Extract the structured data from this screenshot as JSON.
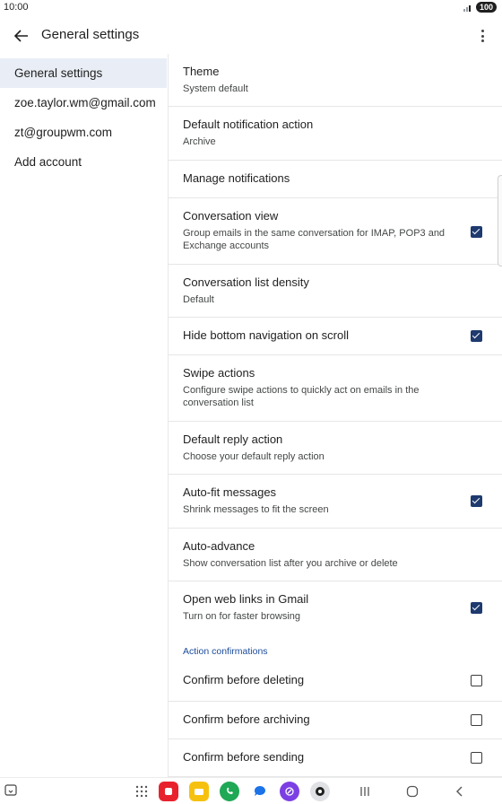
{
  "status": {
    "time": "10:00",
    "battery": "100"
  },
  "app_bar": {
    "title": "General settings"
  },
  "sidebar": {
    "items": [
      {
        "label": "General settings"
      },
      {
        "label": "zoe.taylor.wm@gmail.com"
      },
      {
        "label": "zt@groupwm.com"
      },
      {
        "label": "Add account"
      }
    ]
  },
  "settings": [
    {
      "title": "Theme",
      "subtitle": "System default"
    },
    {
      "title": "Default notification action",
      "subtitle": "Archive"
    },
    {
      "title": "Manage notifications"
    },
    {
      "title": "Conversation view",
      "subtitle": "Group emails in the same conversation for IMAP, POP3 and Exchange accounts",
      "checked": true
    },
    {
      "title": "Conversation list density",
      "subtitle": "Default"
    },
    {
      "title": "Hide bottom navigation on scroll",
      "checked": true
    },
    {
      "title": "Swipe actions",
      "subtitle": "Configure swipe actions to quickly act on emails in the conversation list"
    },
    {
      "title": "Default reply action",
      "subtitle": "Choose your default reply action"
    },
    {
      "title": "Auto-fit messages",
      "subtitle": "Shrink messages to fit the screen",
      "checked": true
    },
    {
      "title": "Auto-advance",
      "subtitle": "Show conversation list after you archive or delete"
    },
    {
      "title": "Open web links in Gmail",
      "subtitle": "Turn on for faster browsing",
      "checked": true
    }
  ],
  "action_confirmations": {
    "header": "Action confirmations",
    "items": [
      {
        "title": "Confirm before deleting",
        "checked": false
      },
      {
        "title": "Confirm before archiving",
        "checked": false
      },
      {
        "title": "Confirm before sending",
        "checked": false
      }
    ]
  },
  "nav_bar": {
    "dock_apps": [
      "app-drawer-icon",
      "red-app-icon",
      "notes-app-icon",
      "whatsapp-icon",
      "messages-icon",
      "browser-icon",
      "camera-icon"
    ],
    "colors": {
      "red": "#e8222d",
      "yellow": "#f6c10e",
      "green": "#1fa855",
      "blue": "#1a73e8",
      "purple": "#7b3fe4"
    }
  }
}
